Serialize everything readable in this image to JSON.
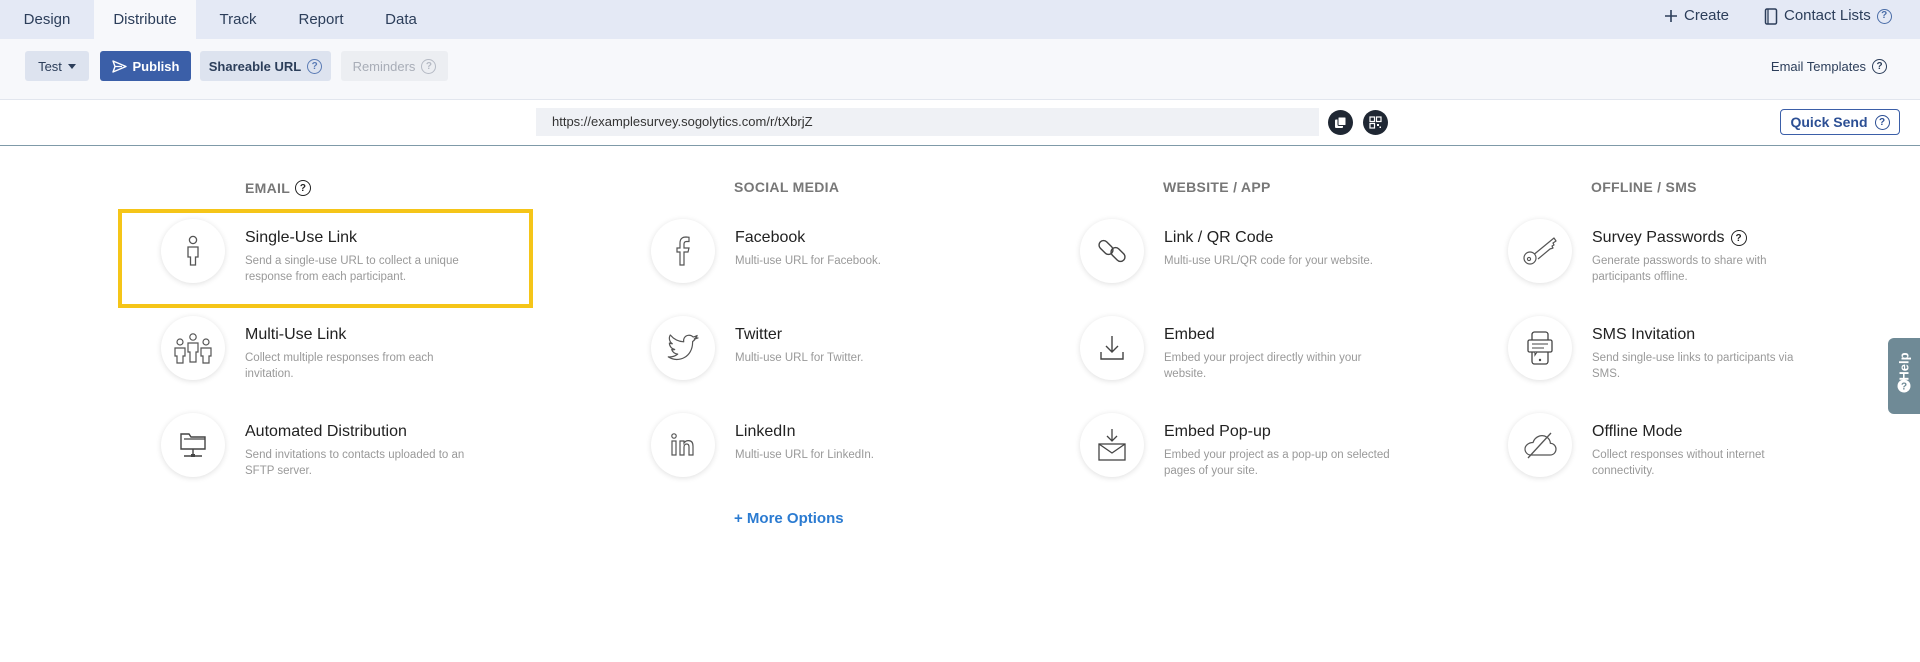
{
  "tabs": [
    {
      "label": "Design"
    },
    {
      "label": "Distribute"
    },
    {
      "label": "Track"
    },
    {
      "label": "Report"
    },
    {
      "label": "Data"
    }
  ],
  "header": {
    "create_label": "Create",
    "contact_lists_label": "Contact Lists"
  },
  "toolbar": {
    "test_label": "Test",
    "publish_label": "Publish",
    "shareable_url_label": "Shareable URL",
    "reminders_label": "Reminders",
    "email_templates_label": "Email Templates"
  },
  "url_bar": {
    "url": "https://examplesurvey.sogolytics.com/r/tXbrjZ",
    "quick_send_label": "Quick Send"
  },
  "columns": [
    {
      "heading": "EMAIL",
      "items": [
        {
          "title": "Single-Use Link",
          "desc": "Send a single-use URL to collect a unique response from each participant.",
          "icon": "person-icon"
        },
        {
          "title": "Multi-Use Link",
          "desc": "Collect multiple responses from each invitation.",
          "icon": "people-group-icon"
        },
        {
          "title": "Automated Distribution",
          "desc": "Send invitations to contacts uploaded to an SFTP server.",
          "icon": "folder-network-icon"
        }
      ]
    },
    {
      "heading": "SOCIAL MEDIA",
      "items": [
        {
          "title": "Facebook",
          "desc": "Multi-use URL for Facebook.",
          "icon": "facebook-icon"
        },
        {
          "title": "Twitter",
          "desc": "Multi-use URL for Twitter.",
          "icon": "twitter-icon"
        },
        {
          "title": "LinkedIn",
          "desc": "Multi-use URL for LinkedIn.",
          "icon": "linkedin-icon"
        }
      ]
    },
    {
      "heading": "WEBSITE / APP",
      "items": [
        {
          "title": "Link / QR Code",
          "desc": "Multi-use URL/QR code for your website.",
          "icon": "link-icon"
        },
        {
          "title": "Embed",
          "desc": "Embed your project directly within your website.",
          "icon": "download-icon"
        },
        {
          "title": "Embed Pop-up",
          "desc": "Embed your project as a pop-up on selected pages of your site.",
          "icon": "envelope-download-icon"
        }
      ]
    },
    {
      "heading": "OFFLINE / SMS",
      "items": [
        {
          "title": "Survey Passwords",
          "desc": "Generate passwords to share with participants offline.",
          "icon": "key-icon"
        },
        {
          "title": "SMS Invitation",
          "desc": "Send single-use links to participants via SMS.",
          "icon": "phone-message-icon"
        },
        {
          "title": "Offline Mode",
          "desc": "Collect responses without internet connectivity.",
          "icon": "cloud-off-icon"
        }
      ]
    }
  ],
  "more_options_label": "+ More Options",
  "help_label": "Help",
  "colors": {
    "tabbar_bg": "#e4e9f5",
    "primary": "#3b5fa8",
    "highlight": "#f5c518",
    "link": "#2b7bd1"
  }
}
